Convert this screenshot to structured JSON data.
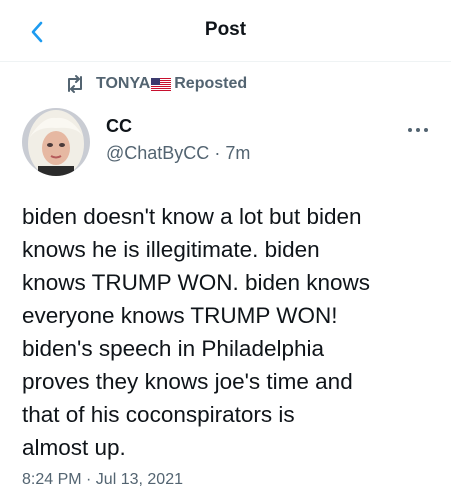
{
  "header": {
    "title": "Post",
    "back_icon": "chevron-left-icon",
    "accent_color": "#1d9bf0"
  },
  "repost": {
    "icon": "repost-icon",
    "user": "TONYA",
    "flag_icon": "us-flag-icon",
    "label": "Reposted"
  },
  "tweet": {
    "author_name": "CC",
    "handle": "@ChatByCC",
    "separator": "·",
    "age": "7m",
    "more_icon": "more-horizontal-icon",
    "text": "biden doesn't know a lot but biden\nknows he is illegitimate. biden\nknows TRUMP WON. biden knows\neveryone knows TRUMP WON!\nbiden's speech in Philadelphia\nproves they knows joe's time and\nthat of his coconspirators is\nalmost up.",
    "timestamp": "8:24 PM · Jul 13, 2021"
  },
  "colors": {
    "text_primary": "#0f1419",
    "text_secondary": "#536471",
    "divider": "#eff3f4"
  }
}
